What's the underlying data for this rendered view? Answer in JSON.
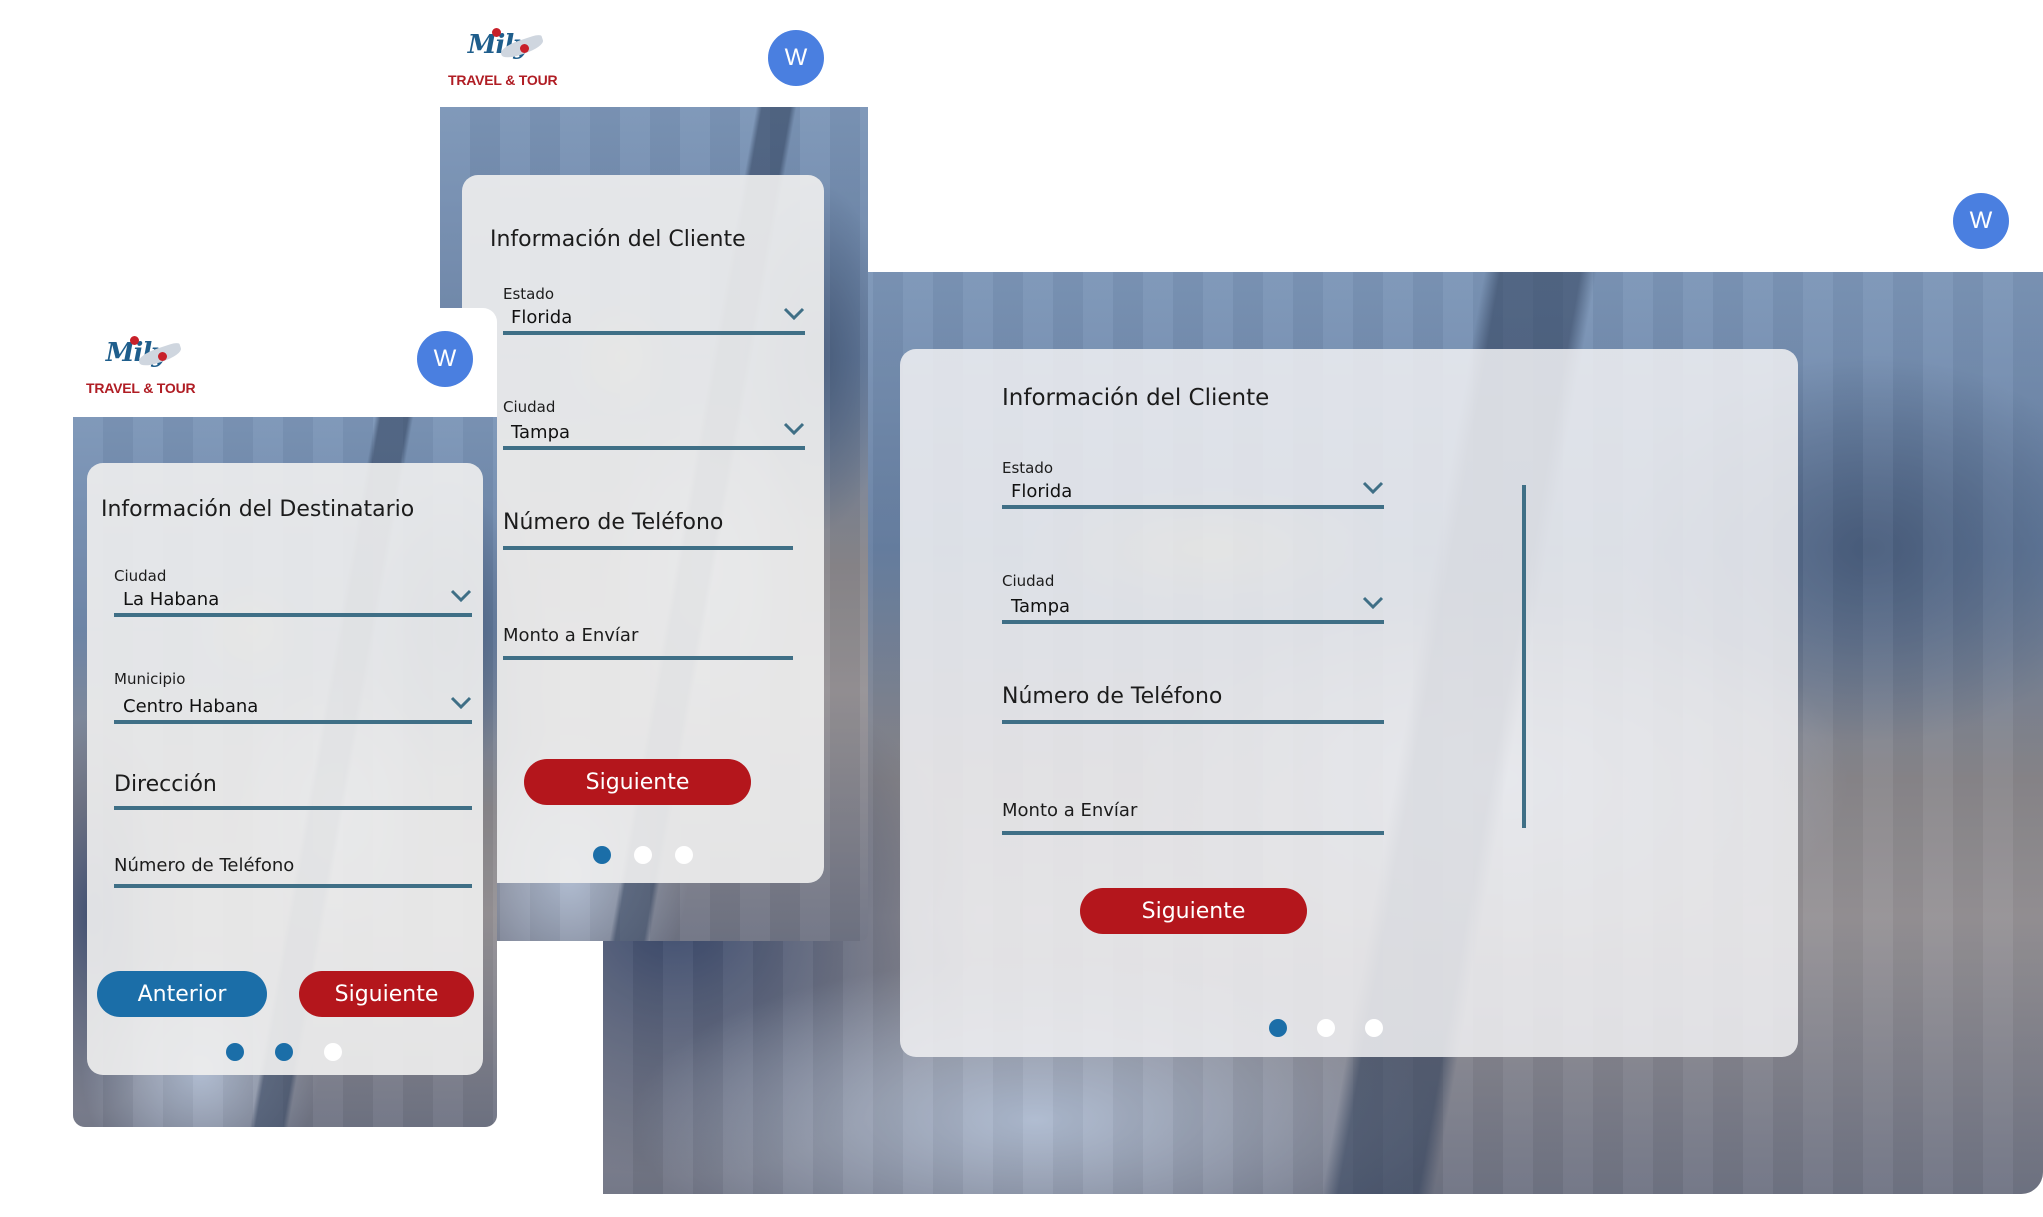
{
  "brand": {
    "name": "Mily",
    "tagline": "TRAVEL & TOUR"
  },
  "avatar_letter": "W",
  "colors": {
    "primary_red": "#b4161c",
    "primary_blue": "#1b6ea8",
    "field_line": "#3f6f86",
    "avatar": "#4a7fe0"
  },
  "mobile_destinatario": {
    "title": "Información del Destinatario",
    "ciudad_label": "Ciudad",
    "ciudad_value": "La Habana",
    "municipio_label": "Municipio",
    "municipio_value": "Centro Habana",
    "direccion_placeholder": "Dirección",
    "telefono_placeholder": "Número de Teléfono",
    "back_label": "Anterior",
    "next_label": "Siguiente",
    "step_dots": [
      true,
      true,
      false
    ]
  },
  "mobile_cliente": {
    "title": "Información del Cliente",
    "estado_label": "Estado",
    "estado_value": "Florida",
    "ciudad_label": "Ciudad",
    "ciudad_value": "Tampa",
    "telefono_placeholder": "Número de Teléfono",
    "monto_placeholder": "Monto a Envíar",
    "next_label": "Siguiente",
    "step_dots": [
      true,
      false,
      false
    ]
  },
  "desktop_cliente": {
    "title": "Información del Cliente",
    "estado_label": "Estado",
    "estado_value": "Florida",
    "ciudad_label": "Ciudad",
    "ciudad_value": "Tampa",
    "telefono_placeholder": "Número de Teléfono",
    "monto_placeholder": "Monto a Envíar",
    "next_label": "Siguiente",
    "step_dots": [
      true,
      false,
      false
    ]
  }
}
